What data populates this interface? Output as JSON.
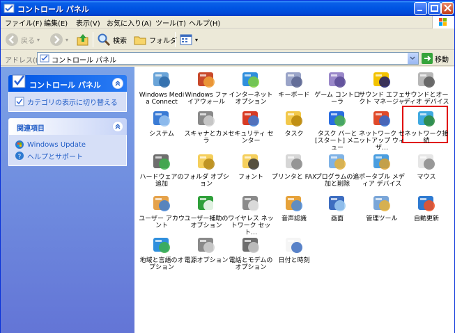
{
  "window": {
    "title": "コントロール パネル"
  },
  "menu": [
    "ファイル(F)",
    "編集(E)",
    "表示(V)",
    "お気に入り(A)",
    "ツール(T)",
    "ヘルプ(H)"
  ],
  "toolbar": {
    "back_label": "戻る",
    "search_label": "検索",
    "folders_label": "フォルダ"
  },
  "address": {
    "label": "アドレス(D)",
    "value": "コントロール パネル",
    "go_label": "移動"
  },
  "taskpane": {
    "primary_title": "コントロール パネル",
    "switch_view_link": "カテゴリの表示に切り替える",
    "related_title": "関連項目",
    "links": [
      "Windows Update",
      "ヘルプとサポート"
    ]
  },
  "icons": [
    {
      "label": "Windows Media Connect",
      "icon": "media-connect-icon"
    },
    {
      "label": "Windows ファイアウォール",
      "icon": "firewall-icon"
    },
    {
      "label": "インターネット オプション",
      "icon": "internet-options-icon"
    },
    {
      "label": "キーボード",
      "icon": "keyboard-icon"
    },
    {
      "label": "ゲーム コントローラ",
      "icon": "game-controller-icon"
    },
    {
      "label": "サウンド エフェクト マネージャ",
      "icon": "sound-effect-icon"
    },
    {
      "label": "サウンドとオーディオ デバイス",
      "icon": "speaker-icon"
    },
    {
      "label": "システム",
      "icon": "system-icon"
    },
    {
      "label": "スキャナとカメラ",
      "icon": "scanner-camera-icon"
    },
    {
      "label": "セキュリティ センター",
      "icon": "security-center-icon"
    },
    {
      "label": "タスク",
      "icon": "scheduled-tasks-icon"
    },
    {
      "label": "タスク バーと [スタート] メニュー",
      "icon": "taskbar-icon"
    },
    {
      "label": "ネットワーク セットアップ ウィザ…",
      "icon": "network-setup-icon"
    },
    {
      "label": "ネットワーク接続",
      "icon": "network-connections-icon"
    },
    {
      "label": "ハードウェアの追加",
      "icon": "add-hardware-icon"
    },
    {
      "label": "フォルダ オプション",
      "icon": "folder-options-icon"
    },
    {
      "label": "フォント",
      "icon": "fonts-icon"
    },
    {
      "label": "プリンタと FAX",
      "icon": "printers-fax-icon"
    },
    {
      "label": "プログラムの追加と削除",
      "icon": "add-remove-programs-icon"
    },
    {
      "label": "ポータブル メディア デバイス",
      "icon": "portable-media-icon"
    },
    {
      "label": "マウス",
      "icon": "mouse-icon"
    },
    {
      "label": "ユーザー アカウント",
      "icon": "user-accounts-icon"
    },
    {
      "label": "ユーザー補助のオプション",
      "icon": "accessibility-icon"
    },
    {
      "label": "ワイヤレス ネットワーク セット…",
      "icon": "wireless-network-icon"
    },
    {
      "label": "音声認識",
      "icon": "speech-icon"
    },
    {
      "label": "画面",
      "icon": "display-icon"
    },
    {
      "label": "管理ツール",
      "icon": "admin-tools-icon"
    },
    {
      "label": "自動更新",
      "icon": "automatic-updates-icon"
    },
    {
      "label": "地域と言語のオプション",
      "icon": "regional-language-icon"
    },
    {
      "label": "電源オプション",
      "icon": "power-options-icon"
    },
    {
      "label": "電話とモデムのオプション",
      "icon": "phone-modem-icon"
    },
    {
      "label": "日付と時刻",
      "icon": "date-time-icon"
    }
  ]
}
